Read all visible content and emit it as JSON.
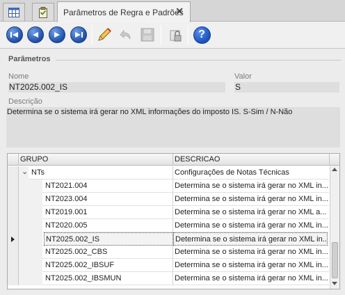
{
  "tab": {
    "title": "Parâmetros de Regra e Padrões",
    "close": "✕"
  },
  "toolbar": {
    "buttons": [
      {
        "name": "first-record-icon",
        "enabled": true
      },
      {
        "name": "previous-record-icon",
        "enabled": true
      },
      {
        "name": "next-record-icon",
        "enabled": true
      },
      {
        "name": "last-record-icon",
        "enabled": true
      },
      {
        "name": "edit-pencil-icon",
        "enabled": true
      },
      {
        "name": "undo-icon",
        "enabled": false
      },
      {
        "name": "save-disk-icon",
        "enabled": false
      },
      {
        "name": "lock-icon",
        "enabled": true
      },
      {
        "name": "help-icon",
        "enabled": true
      }
    ],
    "help_glyph": "?"
  },
  "parametros": {
    "section_title": "Parâmetros",
    "nome_label": "Nome",
    "nome_value": "NT2025.002_IS",
    "valor_label": "Valor",
    "valor_value": "S",
    "descricao_label": "Descrição",
    "descricao_value": "Determina se o sistema irá gerar no XML informações do imposto IS. S-Sim / N-Não"
  },
  "grid": {
    "headers": {
      "grupo": "GRUPO",
      "descricao": "DESCRICAO"
    },
    "group": {
      "grupo": "NTs",
      "descricao": "Configurações de Notas Técnicas",
      "expand_glyph": "⌄"
    },
    "rows": [
      {
        "grupo": "NT2021.004",
        "descricao": "Determina se o sistema irá gerar no XML in..."
      },
      {
        "grupo": "NT2023.004",
        "descricao": "Determina se o sistema irá gerar no XML in..."
      },
      {
        "grupo": "NT2019.001",
        "descricao": "Determina se o sistema irá gerar no XML a..."
      },
      {
        "grupo": "NT2020.005",
        "descricao": "Determina se o sistema irá gerar no XML in..."
      },
      {
        "grupo": "NT2025.002_IS",
        "descricao": "Determina se o sistema irá gerar no XML in..."
      },
      {
        "grupo": "NT2025.002_CBS",
        "descricao": "Determina se o sistema irá gerar no XML in..."
      },
      {
        "grupo": "NT2025.002_IBSUF",
        "descricao": "Determina se o sistema irá gerar no XML in..."
      },
      {
        "grupo": "NT2025.002_IBSMUN",
        "descricao": "Determina se o sistema irá gerar no XML in..."
      }
    ],
    "selected_index": 4
  },
  "colors": {
    "nav_blue": "#1f4fa7",
    "help_blue": "#1a52b8",
    "field_bg": "#dedede"
  }
}
